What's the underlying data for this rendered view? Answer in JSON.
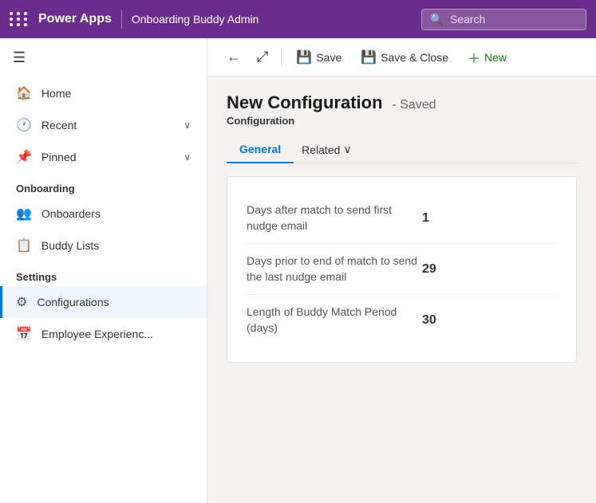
{
  "topnav": {
    "brand": "Power Apps",
    "app_name": "Onboarding Buddy Admin",
    "search_placeholder": "Search"
  },
  "toolbar": {
    "back_label": "←",
    "expand_label": "⤢",
    "save_label": "Save",
    "save_close_label": "Save & Close",
    "new_label": "New"
  },
  "page": {
    "title": "New Configuration",
    "status": "- Saved",
    "subtitle": "Configuration"
  },
  "tabs": [
    {
      "label": "General",
      "active": true
    },
    {
      "label": "Related",
      "active": false,
      "has_dropdown": true
    }
  ],
  "form_fields": [
    {
      "label": "Days after match to send first nudge email",
      "value": "1"
    },
    {
      "label": "Days prior to end of match to send the last nudge email",
      "value": "29"
    },
    {
      "label": "Length of Buddy Match Period (days)",
      "value": "30"
    }
  ],
  "sidebar": {
    "nav_items": [
      {
        "id": "home",
        "label": "Home",
        "icon": "🏠",
        "has_chevron": false
      },
      {
        "id": "recent",
        "label": "Recent",
        "icon": "🕐",
        "has_chevron": true
      },
      {
        "id": "pinned",
        "label": "Pinned",
        "icon": "📌",
        "has_chevron": true
      }
    ],
    "sections": [
      {
        "title": "Onboarding",
        "items": [
          {
            "id": "onboarders",
            "label": "Onboarders",
            "icon": "👥"
          },
          {
            "id": "buddy-lists",
            "label": "Buddy Lists",
            "icon": "📋"
          }
        ]
      },
      {
        "title": "Settings",
        "items": [
          {
            "id": "configurations",
            "label": "Configurations",
            "icon": "⚙",
            "active": true
          },
          {
            "id": "employee-experience",
            "label": "Employee Experienc...",
            "icon": "📅"
          }
        ]
      }
    ]
  }
}
